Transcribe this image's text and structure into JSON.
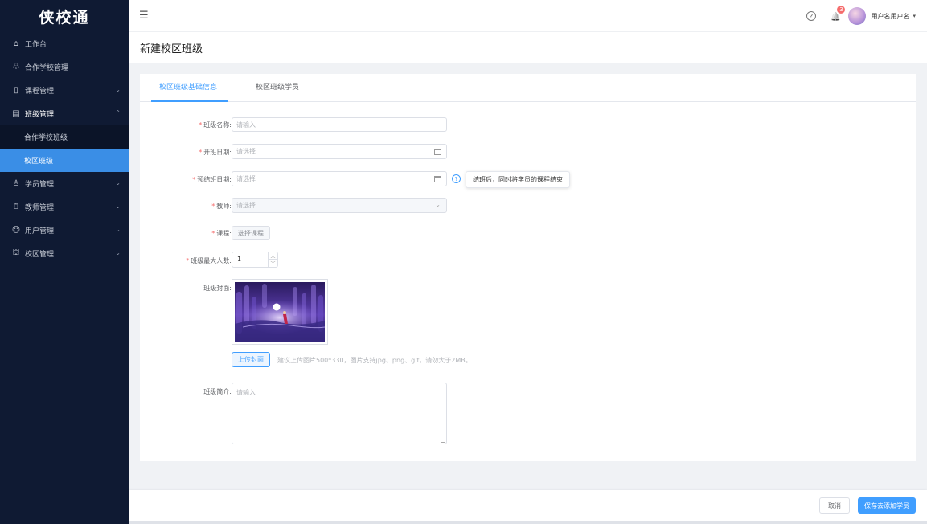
{
  "sidebar": {
    "logo": "侠校通",
    "items": [
      {
        "label": "工作台",
        "icon": "⌂",
        "chev": ""
      },
      {
        "label": "合作学校管理",
        "icon": "♧",
        "chev": ""
      },
      {
        "label": "课程管理",
        "icon": "▯",
        "chev": "⌄"
      },
      {
        "label": "班级管理",
        "icon": "▤",
        "chev": "⌃"
      },
      {
        "label": "合作学校班级"
      },
      {
        "label": "校区班级"
      },
      {
        "label": "学员管理",
        "icon": "♙",
        "chev": "⌄"
      },
      {
        "label": "教师管理",
        "icon": "♖",
        "chev": "⌄"
      },
      {
        "label": "用户管理",
        "icon": "☺",
        "chev": "⌄"
      },
      {
        "label": "校区管理",
        "icon": "⛫",
        "chev": "⌄"
      }
    ]
  },
  "topbar": {
    "menu_icon": "☰",
    "help": "?",
    "bell": "🔔",
    "badge": "3",
    "username": "用户名用户名",
    "caret": "▾"
  },
  "page": {
    "title": "新建校区班级"
  },
  "tabs": [
    {
      "label": "校区班级基础信息"
    },
    {
      "label": "校区班级学员"
    }
  ],
  "form": {
    "required_mark": "*",
    "class_name": {
      "label": "班级名称:",
      "placeholder": "请输入"
    },
    "start_date": {
      "label": "开班日期:",
      "placeholder": "请选择"
    },
    "end_date": {
      "label": "预结班日期:",
      "placeholder": "请选择",
      "tooltip": "结班后，同时将学员的课程结束",
      "help": "?"
    },
    "teacher": {
      "label": "教师:",
      "placeholder": "请选择",
      "chev": "⌄"
    },
    "course": {
      "label": "课程:",
      "button": "选择课程"
    },
    "max_students": {
      "label": "班级最大人数:",
      "value": "1",
      "up": "︿",
      "down": "﹀"
    },
    "cover": {
      "label": "班级封面:",
      "upload": "上传封面",
      "hint": "建议上传图片500*330，图片支持jpg、png、gif，请勿大于2MB。"
    },
    "intro": {
      "label": "班级简介:",
      "placeholder": "请输入"
    }
  },
  "footer": {
    "cancel": "取消",
    "save": "保存去添加学员"
  }
}
